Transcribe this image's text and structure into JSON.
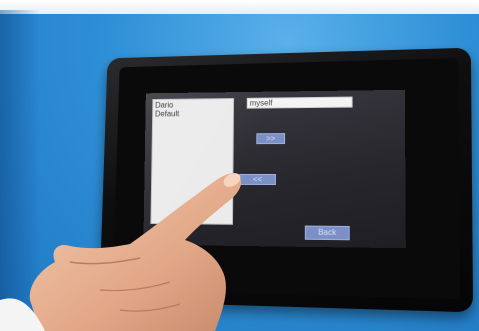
{
  "screen": {
    "user_list": [
      "Dario",
      "Default"
    ],
    "name_field_value": "myself",
    "add_button_label": ">>",
    "remove_button_label": "<<",
    "back_button_label": "Back"
  },
  "colors": {
    "housing_blue": "#2e8fd6",
    "bezel": "#0e0e10",
    "screen_background": "#2a2930",
    "button": "#7c90c8",
    "list_background": "#ebebeb"
  }
}
